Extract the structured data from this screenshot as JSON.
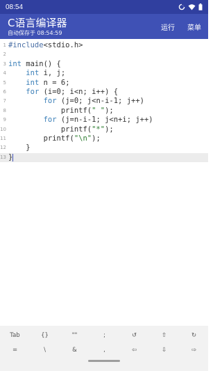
{
  "status_bar": {
    "time": "08:54",
    "icons": [
      "data-saver-icon",
      "wifi-icon",
      "battery-icon"
    ]
  },
  "app_bar": {
    "title": "C语言编译器",
    "subtitle": "自动保存于 08:54:59",
    "actions": {
      "run": "运行",
      "menu": "菜单"
    }
  },
  "editor": {
    "current_line": 13,
    "lines": [
      {
        "num": "1",
        "tokens": [
          {
            "t": "pp",
            "v": "#include"
          },
          {
            "t": "",
            "v": "<stdio.h>"
          }
        ]
      },
      {
        "num": "2",
        "tokens": []
      },
      {
        "num": "3",
        "tokens": [
          {
            "t": "kw",
            "v": "int"
          },
          {
            "t": "",
            "v": " main() {"
          }
        ]
      },
      {
        "num": "4",
        "tokens": [
          {
            "t": "",
            "v": "    "
          },
          {
            "t": "kw",
            "v": "int"
          },
          {
            "t": "",
            "v": " i, j;"
          }
        ]
      },
      {
        "num": "5",
        "tokens": [
          {
            "t": "",
            "v": "    "
          },
          {
            "t": "kw",
            "v": "int"
          },
          {
            "t": "",
            "v": " n = 6;"
          }
        ]
      },
      {
        "num": "6",
        "tokens": [
          {
            "t": "",
            "v": "    "
          },
          {
            "t": "kw",
            "v": "for"
          },
          {
            "t": "",
            "v": " (i=0; i<n; i++) {"
          }
        ]
      },
      {
        "num": "7",
        "tokens": [
          {
            "t": "",
            "v": "        "
          },
          {
            "t": "kw",
            "v": "for"
          },
          {
            "t": "",
            "v": " (j=0; j<n-i-1; j++)"
          }
        ]
      },
      {
        "num": "8",
        "tokens": [
          {
            "t": "",
            "v": "            printf("
          },
          {
            "t": "str",
            "v": "\" \""
          },
          {
            "t": "",
            "v": ");"
          }
        ]
      },
      {
        "num": "9",
        "tokens": [
          {
            "t": "",
            "v": "        "
          },
          {
            "t": "kw",
            "v": "for"
          },
          {
            "t": "",
            "v": " (j=n-i-1; j<n+i; j++)"
          }
        ]
      },
      {
        "num": "10",
        "tokens": [
          {
            "t": "",
            "v": "            printf("
          },
          {
            "t": "str",
            "v": "\"*\""
          },
          {
            "t": "",
            "v": ");"
          }
        ]
      },
      {
        "num": "11",
        "tokens": [
          {
            "t": "",
            "v": "        printf("
          },
          {
            "t": "str",
            "v": "\"\\n\""
          },
          {
            "t": "",
            "v": ");"
          }
        ]
      },
      {
        "num": "12",
        "tokens": [
          {
            "t": "",
            "v": "    }"
          }
        ]
      },
      {
        "num": "13",
        "tokens": [
          {
            "t": "",
            "v": "}"
          }
        ]
      }
    ]
  },
  "keyboard": {
    "row1": [
      {
        "label": "Tab",
        "name": "tab-key"
      },
      {
        "label": "{}",
        "name": "braces-key"
      },
      {
        "label": "\"\"",
        "name": "quotes-key"
      },
      {
        "label": ";",
        "name": "semicolon-key"
      },
      {
        "label": "↺",
        "name": "undo-icon"
      },
      {
        "label": "⇧",
        "name": "shift-up-icon"
      },
      {
        "label": "↻",
        "name": "redo-icon"
      }
    ],
    "row2": [
      {
        "label": "=",
        "name": "equals-key"
      },
      {
        "label": "\\",
        "name": "backslash-key"
      },
      {
        "label": "&",
        "name": "ampersand-key"
      },
      {
        "label": ",",
        "name": "comma-key"
      },
      {
        "label": "⇦",
        "name": "arrow-left-icon"
      },
      {
        "label": "⇩",
        "name": "arrow-down-icon"
      },
      {
        "label": "⇨",
        "name": "arrow-right-icon"
      }
    ]
  }
}
